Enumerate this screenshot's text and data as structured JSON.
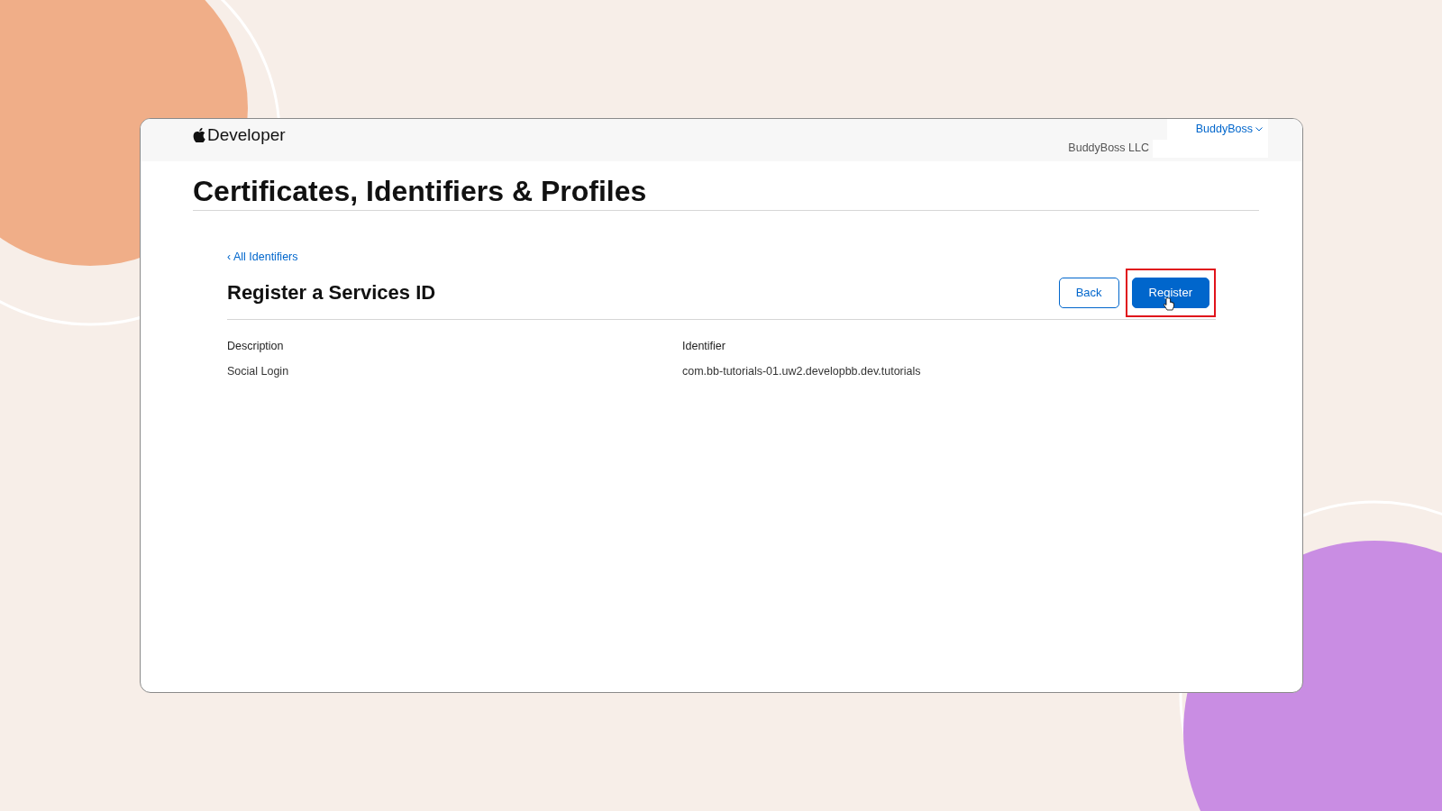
{
  "header": {
    "logo": "Developer",
    "account_menu": "BuddyBoss",
    "team_name": "BuddyBoss LLC"
  },
  "page_title": "Certificates, Identifiers & Profiles",
  "back_link": "‹ All Identifiers",
  "section_title": "Register a Services ID",
  "buttons": [
    {
      "label": "Back",
      "kind": "secondary",
      "highlighted": false
    },
    {
      "label": "Register",
      "kind": "primary",
      "highlighted": true
    }
  ],
  "fields": [
    {
      "label": "Description",
      "value": "Social Login"
    },
    {
      "label": "Identifier",
      "value": "com.bb-tutorials-01.uw2.developbb.dev.tutorials"
    }
  ]
}
